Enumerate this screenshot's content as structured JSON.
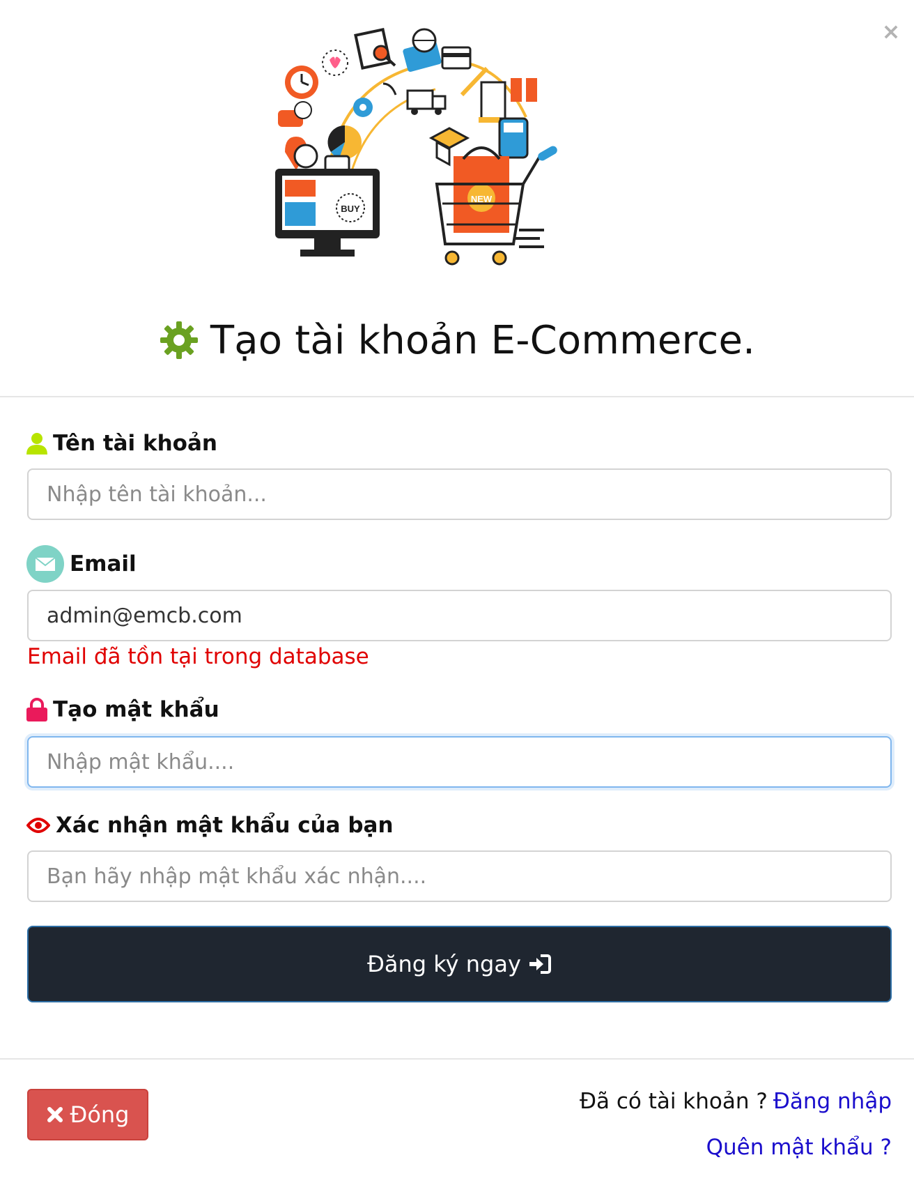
{
  "modal": {
    "close_glyph": "×",
    "title": "Tạo tài khoản E-Commerce."
  },
  "hero": {
    "monitor_badge": "BUY",
    "bag_badge": "NEW",
    "colors": {
      "orange": "#f15a24",
      "blue": "#2f9bd7",
      "yellow": "#f7b733",
      "dark": "#222222",
      "green": "#6aa121"
    }
  },
  "form": {
    "username": {
      "label": "Tên tài khoản",
      "placeholder": "Nhập tên tài khoản...",
      "value": ""
    },
    "email": {
      "label": "Email",
      "placeholder": "",
      "value": "admin@emcb.com",
      "error": "Email đã tồn tại trong database"
    },
    "password": {
      "label": "Tạo mật khẩu",
      "placeholder": "Nhập mật khẩu....",
      "value": ""
    },
    "confirm": {
      "label": "Xác nhận mật khẩu của bạn",
      "placeholder": "Bạn hãy nhập mật khẩu xác nhận....",
      "value": ""
    },
    "submit_label": "Đăng ký ngay"
  },
  "footer": {
    "close_label": "Đóng",
    "have_account": "Đã có tài khoản ?",
    "login_link": "Đăng nhập",
    "forgot_link": "Quên mật khẩu ?"
  },
  "icons": {
    "title_icon": "gear-icon",
    "username_icon": "user-icon",
    "email_icon": "envelope-icon",
    "password_icon": "lock-icon",
    "confirm_icon": "eye-icon",
    "submit_icon": "sign-in-icon",
    "close_icon": "x-icon"
  },
  "colors": {
    "gear": "#6aa121",
    "user": "#b8e400",
    "envelope_bg": "#7fd3c6",
    "lock": "#ea1a5b",
    "eye": "#e00000",
    "error": "#e00000",
    "submit_bg": "#1f2630",
    "close_bg": "#d9534f",
    "link": "#1a0dcc"
  }
}
